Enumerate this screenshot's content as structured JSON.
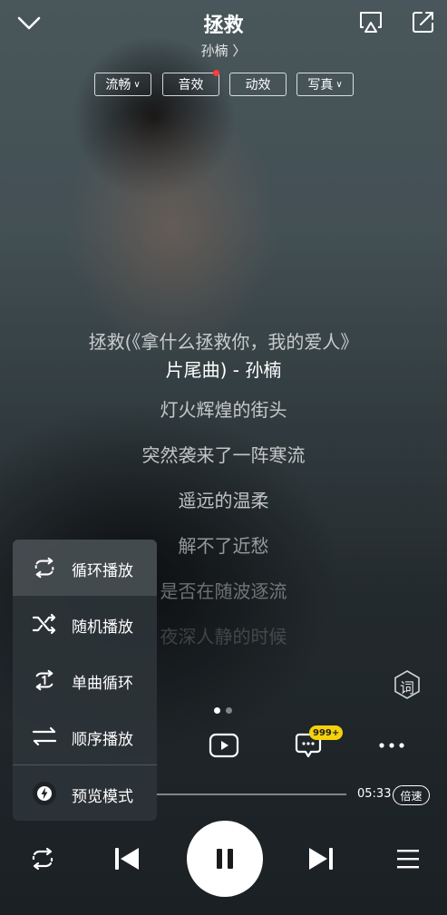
{
  "header": {
    "title": "拯救",
    "artist": "孙楠 〉"
  },
  "chips": {
    "quality": "流畅",
    "sound_effect": "音效",
    "visual_effect": "动效",
    "photo": "写真"
  },
  "lyrics": [
    "拯救(《拿什么拯救你，我的爱人》",
    "片尾曲) - 孙楠",
    "灯火辉煌的街头",
    "突然袭来了一阵寒流",
    "遥远的温柔",
    "解不了近愁",
    "是否在随波逐流",
    "夜深人静的时候"
  ],
  "lyrics_button": "词",
  "comments_badge": "999+",
  "player": {
    "total_time": "05:33",
    "speed_label": "倍速"
  },
  "mode_menu": {
    "items": [
      {
        "label": "循环播放",
        "icon": "loop-icon"
      },
      {
        "label": "随机播放",
        "icon": "shuffle-icon"
      },
      {
        "label": "单曲循环",
        "icon": "repeat-one-icon"
      },
      {
        "label": "顺序播放",
        "icon": "sequential-icon"
      },
      {
        "label": "预览模式",
        "icon": "lightning-icon"
      }
    ],
    "selected_index": 0
  },
  "colors": {
    "badge": "#f5d20b",
    "red_dot": "#ff3b3b"
  }
}
